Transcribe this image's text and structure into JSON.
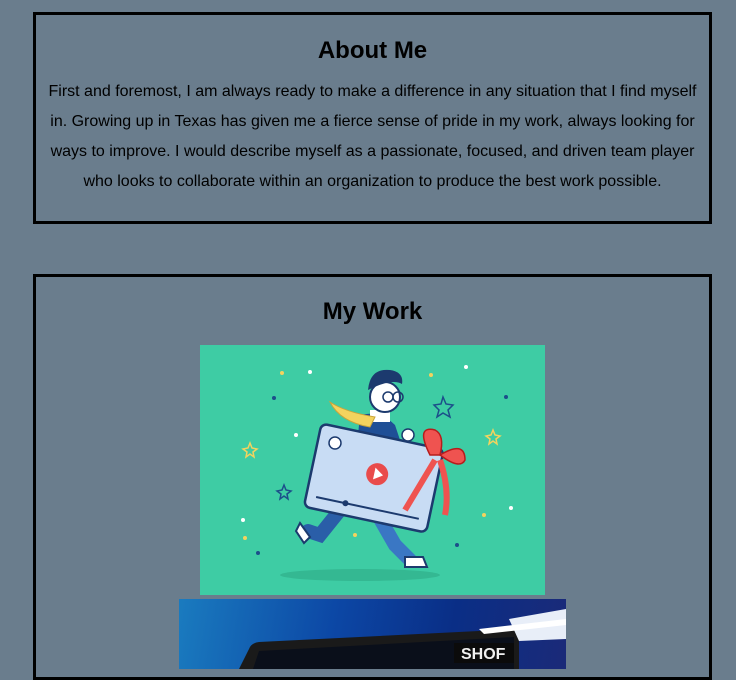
{
  "about": {
    "title": "About Me",
    "text": "First and foremost, I am always ready to make a difference in any situation that I find myself in. Growing up in Texas has given me a fierce sense of pride in my work, always looking for ways to improve. I would describe myself as a passionate, focused, and driven team player who looks to collaborate within an organization to produce the best work possible."
  },
  "work": {
    "title": "My Work",
    "images": [
      {
        "icon": "illustration-person-carrying-video-gift"
      },
      {
        "icon": "illustration-computer-monitor"
      }
    ]
  },
  "colors": {
    "background": "#6a7d8d",
    "illustration_bg": "#3ecca4",
    "border": "#000000"
  }
}
